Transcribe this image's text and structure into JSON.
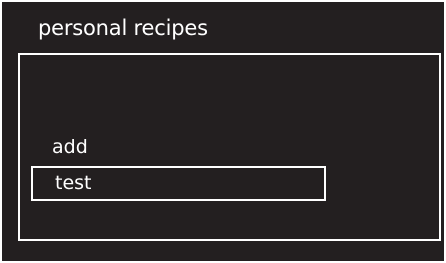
{
  "title": "personal recipes",
  "menu": {
    "items": [
      {
        "label": "add",
        "selected": false
      },
      {
        "label": "test",
        "selected": true
      }
    ]
  },
  "colors": {
    "background": "#231f20",
    "foreground": "#ffffff"
  }
}
